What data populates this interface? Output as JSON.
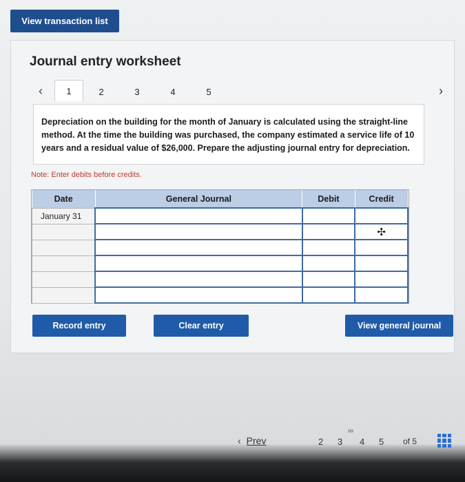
{
  "top_button": {
    "label": "View transaction list"
  },
  "worksheet": {
    "title": "Journal entry worksheet",
    "tabs": [
      "1",
      "2",
      "3",
      "4",
      "5"
    ],
    "active_tab": "1",
    "description": "Depreciation on the building for the month of January is calculated using the straight-line method. At the time the building was purchased, the company estimated a service life of 10 years and a residual value of $26,000. Prepare the adjusting journal entry for depreciation.",
    "note_prefix": "Note:",
    "note_text": "Enter debits before credits."
  },
  "journal": {
    "headers": {
      "date": "Date",
      "general_journal": "General Journal",
      "debit": "Debit",
      "credit": "Credit"
    },
    "rows": [
      {
        "date": "January 31",
        "account": "",
        "debit": "",
        "credit": ""
      },
      {
        "date": "",
        "account": "",
        "debit": "",
        "credit": ""
      },
      {
        "date": "",
        "account": "",
        "debit": "",
        "credit": ""
      },
      {
        "date": "",
        "account": "",
        "debit": "",
        "credit": ""
      },
      {
        "date": "",
        "account": "",
        "debit": "",
        "credit": ""
      },
      {
        "date": "",
        "account": "",
        "debit": "",
        "credit": ""
      }
    ]
  },
  "buttons": {
    "record": "Record entry",
    "clear": "Clear entry",
    "view_journal": "View general journal"
  },
  "footer": {
    "prev": "Prev",
    "pages": [
      "2",
      "3",
      "4",
      "5"
    ],
    "of_label": "of 5"
  },
  "colors": {
    "primary_button": "#1f5ba8",
    "header_bg": "#bccde6",
    "note_red": "#c0392b"
  }
}
